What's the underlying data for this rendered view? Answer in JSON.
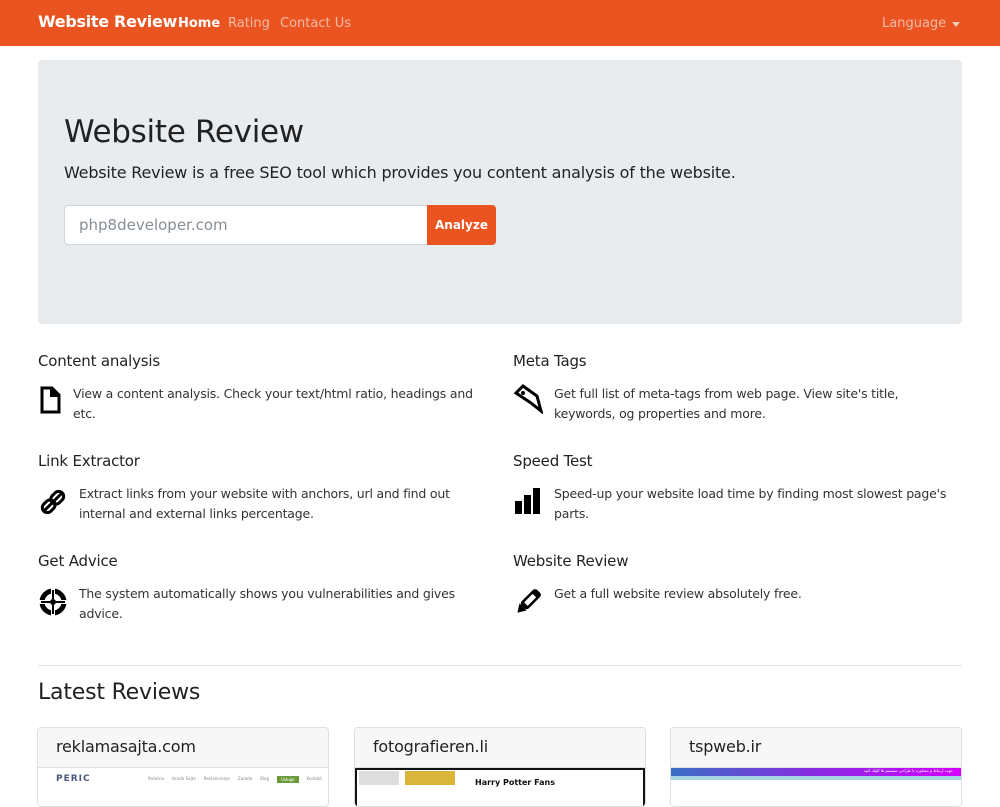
{
  "navbar": {
    "brand": "Website Review",
    "links": [
      {
        "label": "Home",
        "active": true
      },
      {
        "label": "Rating",
        "active": false
      },
      {
        "label": "Contact Us",
        "active": false
      }
    ],
    "language_label": "Language",
    "background_color": "#e95420"
  },
  "hero": {
    "title": "Website Review",
    "lead": "Website Review is a free SEO tool which provides you content analysis of the website.",
    "search": {
      "value": "",
      "placeholder": "php8developer.com"
    },
    "analyze_button": "Analyze"
  },
  "features": [
    {
      "title": "Content analysis",
      "icon": "file-icon",
      "description": "View a content analysis. Check your text/html ratio, headings and etc."
    },
    {
      "title": "Meta Tags",
      "icon": "tag-icon",
      "description": "Get full list of meta-tags from web page. View site's title, keywords, og properties and more."
    },
    {
      "title": "Link Extractor",
      "icon": "link-icon",
      "description": "Extract links from your website with anchors, url and find out internal and external links percentage."
    },
    {
      "title": "Speed Test",
      "icon": "signal-bars-icon",
      "description": "Speed-up your website load time by finding most slowest page's parts."
    },
    {
      "title": "Get Advice",
      "icon": "crosshair-icon",
      "description": "The system automatically shows you vulnerabilities and gives advice."
    },
    {
      "title": "Website Review",
      "icon": "pencil-icon",
      "description": "Get a full website review absolutely free."
    }
  ],
  "latest": {
    "title": "Latest Reviews",
    "cards": [
      {
        "domain": "reklamasajta.com",
        "thumbnail": {
          "logo": "PERIC",
          "nav": [
            "Početna",
            "Izrada Sajta",
            "Reklamiranje",
            "Zarada",
            "Blog",
            "Usluge",
            "Kontakt"
          ]
        }
      },
      {
        "domain": "fotografieren.li",
        "thumbnail": {
          "headline": "Harry Potter Fans"
        }
      },
      {
        "domain": "tspweb.ir",
        "thumbnail": {
          "banner_text": "جهت ارتباط و مشاوره با طراحی سیستم ها کلیک کنید"
        }
      }
    ]
  }
}
